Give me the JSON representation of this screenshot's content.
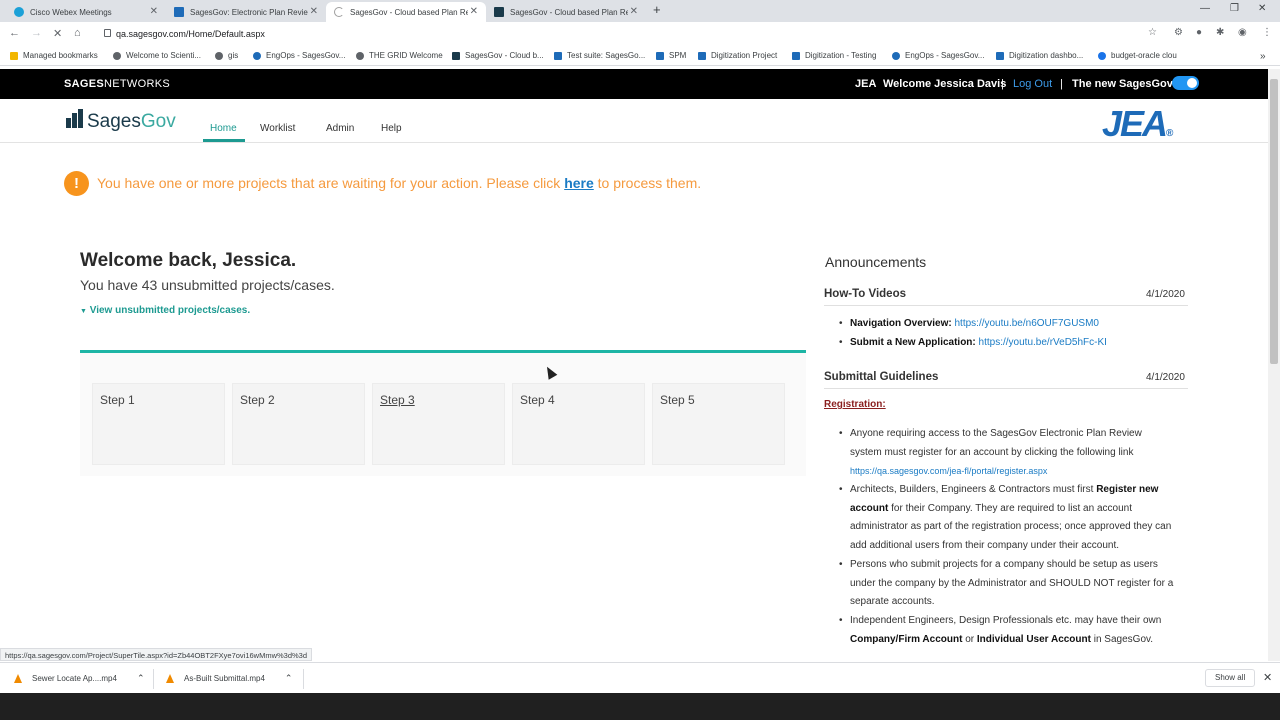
{
  "browser": {
    "tabs": [
      {
        "title": "Cisco Webex Meetings",
        "color": "#1ba0d7",
        "active": false
      },
      {
        "title": "SagesGov: Electronic Plan Review",
        "color": "#1e6bb8",
        "active": false
      },
      {
        "title": "SagesGov - Cloud based Plan Re",
        "color": "#9e9e9e",
        "active": true
      },
      {
        "title": "SagesGov - Cloud based Plan Re",
        "color": "#1a3a4a",
        "active": false
      }
    ],
    "new_tab_label": "+",
    "url": "qa.sagesgov.com/Home/Default.aspx",
    "bookmarks": [
      "Managed bookmarks",
      "Welcome to Scienti...",
      "gis",
      "EngOps - SagesGov...",
      "THE GRID Welcome",
      "SagesGov - Cloud b...",
      "Test suite: SagesGo...",
      "SPM",
      "Digitization Project",
      "Digitization - Testing",
      "EngOps - SagesGov...",
      "Digitization dashbo...",
      "budget-oracle clou"
    ],
    "status_url": "https://qa.sagesgov.com/Project/SuperTile.aspx?id=Zb44OBT2FXye7ovi16wMmw%3d%3d"
  },
  "header": {
    "brand_bold": "SAGES",
    "brand_rest": "NETWORKS",
    "org": "JEA",
    "welcome": "Welcome Jessica Davis",
    "sep": "|",
    "logout": "Log Out",
    "new_sagesgov": "The new SagesGov",
    "toggle_on": true
  },
  "nav": {
    "logo_sages": "Sages",
    "logo_gov": "Gov",
    "items": [
      "Home",
      "Worklist",
      "Admin",
      "Help"
    ],
    "active": "Home",
    "jea_logo": "JEA",
    "jea_dot": "®"
  },
  "alert": {
    "icon": "!",
    "text_before": "You have one or more projects that are waiting for your action. Please click ",
    "link": "here",
    "text_after": " to process them."
  },
  "main": {
    "welcome": "Welcome back, Jessica.",
    "unsubmitted": "You have 43 unsubmitted projects/cases.",
    "view_link": "View unsubmitted projects/cases.",
    "steps": [
      "Step 1",
      "Step 2",
      "Step 3",
      "Step 4",
      "Step 5"
    ]
  },
  "announcements": {
    "title": "Announcements",
    "howto": {
      "heading": "How-To Videos",
      "date": "4/1/2020",
      "items": [
        {
          "label": "Navigation Overview:",
          "link": "https://youtu.be/n6OUF7GUSM0"
        },
        {
          "label": "Submit a New Application:",
          "link": "https://youtu.be/rVeD5hFc-KI"
        }
      ]
    },
    "guidelines": {
      "heading": "Submittal Guidelines",
      "date": "4/1/2020",
      "registration_label": "Registration:",
      "b1_text": "Anyone requiring access to the SagesGov Electronic Plan Review system must register for an account by clicking the following link ",
      "b1_link": "https://qa.sagesgov.com/jea-fl/portal/register.aspx",
      "b2_a": "Architects, Builders, Engineers & Contractors must first ",
      "b2_bold": "Register new account",
      "b2_b": "  for their Company. They are required to list an account administrator as part of the registration process; once approved they can add additional users from their company under their account.",
      "b3": "Persons who submit projects for a company should be setup as users under the company by the Administrator and SHOULD NOT register for a separate accounts.",
      "b4_a": "Independent Engineers, Design Professionals etc. may have their own ",
      "b4_bold1": "Company/Firm Account",
      "b4_or": " or ",
      "b4_bold2": "Individual User Account",
      "b4_b": " in SagesGov."
    }
  },
  "downloads": {
    "items": [
      "Sewer Locate Ap....mp4",
      "As-Built Submittal.mp4"
    ],
    "show_all": "Show all"
  }
}
